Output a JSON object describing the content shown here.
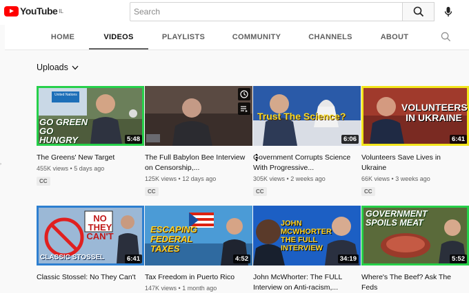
{
  "masthead": {
    "logo_text": "YouTube",
    "country_code": "IL",
    "search_placeholder": "Search"
  },
  "tabs": [
    {
      "label": "HOME"
    },
    {
      "label": "VIDEOS",
      "active": true
    },
    {
      "label": "PLAYLISTS"
    },
    {
      "label": "COMMUNITY"
    },
    {
      "label": "CHANNELS"
    },
    {
      "label": "ABOUT"
    }
  ],
  "section": {
    "label": "Uploads"
  },
  "videos": [
    {
      "title": "The Greens' New Target",
      "views": "455K views",
      "age": "5 days ago",
      "badge": "CC",
      "duration": "5:48",
      "thumb_text": "GO GREEN GO HUNGRY",
      "thumb_sign": "United Nations"
    },
    {
      "title": "The Full Babylon Bee Interview on Censorship,...",
      "views": "125K views",
      "age": "12 days ago",
      "badge": "CC"
    },
    {
      "title": "Government Corrupts Science With Progressive...",
      "views": "305K views",
      "age": "2 weeks ago",
      "badge": "CC",
      "duration": "6:06",
      "thumb_text": "Trust The Science?"
    },
    {
      "title": "Volunteers Save Lives in Ukraine",
      "views": "66K views",
      "age": "3 weeks ago",
      "badge": "CC",
      "duration": "6:41",
      "thumb_text": "VOLUNTEERS IN UKRAINE"
    },
    {
      "title": "Classic Stossel: No They Can't",
      "duration": "6:41",
      "thumb_text": "CLASSIC STOSSEL",
      "thumb_sign": "NO THEY CAN'T"
    },
    {
      "title": "Tax Freedom in Puerto Rico",
      "views": "147K views",
      "age": "1 month ago",
      "duration": "4:52",
      "thumb_text": "ESCAPING FEDERAL TAXES"
    },
    {
      "title": "John McWhorter: The FULL Interview on Anti-racism,...",
      "duration": "34:19",
      "thumb_text": "JOHN MCWHORTER THE FULL INTERVIEW"
    },
    {
      "title": "Where's The Beef? Ask The Feds",
      "duration": "5:52",
      "thumb_text": "GOVERNMENT SPOILS MEAT"
    }
  ],
  "colors": {
    "brand_red": "#ff0000",
    "text_primary": "#0f0f0f",
    "text_secondary": "#606060",
    "green_border": "#26d04a",
    "yellow_border": "#f2e51c"
  }
}
